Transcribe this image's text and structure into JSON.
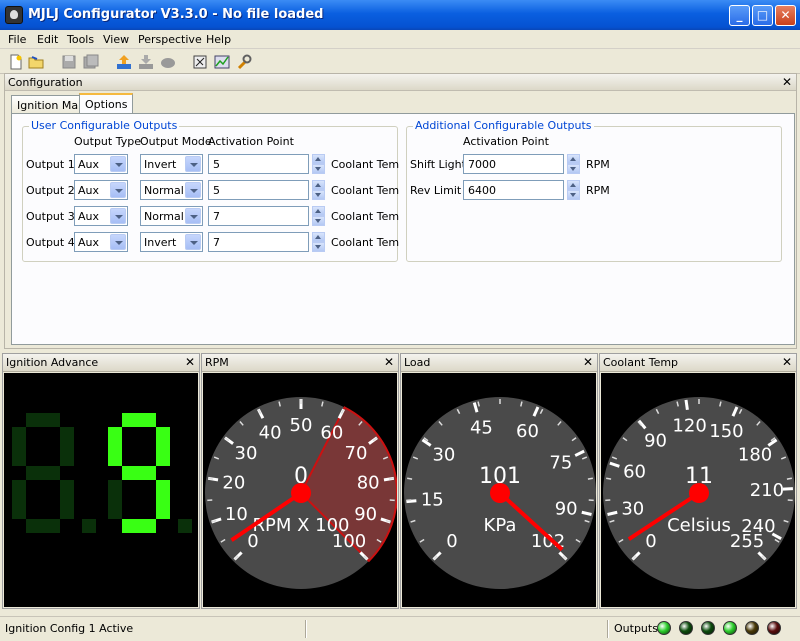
{
  "window": {
    "title": "MJLJ Configurator V3.3.0 - No file loaded"
  },
  "menu": [
    "File",
    "Edit",
    "Tools",
    "View",
    "Perspective",
    "Help"
  ],
  "toolbar_icons": [
    "new-file-icon",
    "open-folder-icon",
    "save-icon",
    "save-all-icon",
    "upload-icon",
    "download-icon",
    "burn-icon",
    "connect-icon",
    "chart-icon",
    "wrench-icon"
  ],
  "config": {
    "title": "Configuration",
    "tabs": [
      "Ignition Map",
      "Options"
    ],
    "active_tab": "Options",
    "user_group": {
      "legend": "User Configurable Outputs",
      "col_type": "Output Type",
      "col_mode": "Output Mode",
      "col_point": "Activation Point",
      "rows": [
        {
          "label": "Output 1",
          "type": "Aux",
          "mode": "Invert",
          "point": "5",
          "unit": "Coolant Tem"
        },
        {
          "label": "Output 2",
          "type": "Aux",
          "mode": "Normal",
          "point": "5",
          "unit": "Coolant Tem"
        },
        {
          "label": "Output 3",
          "type": "Aux",
          "mode": "Normal",
          "point": "7",
          "unit": "Coolant Tem"
        },
        {
          "label": "Output 4",
          "type": "Aux",
          "mode": "Invert",
          "point": "7",
          "unit": "Coolant Tem"
        }
      ]
    },
    "additional_group": {
      "legend": "Additional Configurable Outputs",
      "col_point": "Activation Point",
      "rows": [
        {
          "label": "Shift Light",
          "point": "7000",
          "unit": "RPM"
        },
        {
          "label": "Rev Limit",
          "point": "6400",
          "unit": "RPM"
        }
      ]
    }
  },
  "panels": {
    "advance": {
      "title": "Ignition Advance",
      "digits": [
        "8",
        "9"
      ],
      "lit": [
        false,
        true
      ],
      "lit_color": "#39ff14",
      "dim_color": "#0a300a"
    },
    "rpm": {
      "title": "RPM",
      "labels": [
        "0",
        "10",
        "20",
        "30",
        "40",
        "50",
        "60",
        "70",
        "80",
        "90",
        "100"
      ],
      "value": "0",
      "unit": "RPM X 100",
      "min": "0",
      "max": "100",
      "needle_value": 4
    },
    "load": {
      "title": "Load",
      "labels": [
        "0",
        "15",
        "30",
        "45",
        "60",
        "75",
        "90",
        "102"
      ],
      "value": "101",
      "unit": "KPa",
      "min": "0",
      "max": "102",
      "needle_value": 101
    },
    "coolant": {
      "title": "Coolant Temp",
      "labels": [
        "0",
        "30",
        "60",
        "90",
        "120",
        "150",
        "180",
        "210",
        "240",
        "255"
      ],
      "value": "11",
      "unit": "Celsius",
      "min": "0",
      "max": "255",
      "needle_value": 11
    }
  },
  "status": {
    "text": "Ignition Config 1 Active",
    "outputs_label": "Outputs",
    "leds": [
      "#2ccf2c",
      "#0d4d0d",
      "#0d4d0d",
      "#2ccf2c",
      "#4a3a08",
      "#5a0e0e"
    ]
  },
  "colors": {
    "needle": "#ff0000",
    "gauge_face": "#4a4a4a",
    "redline": "#cc1111"
  }
}
